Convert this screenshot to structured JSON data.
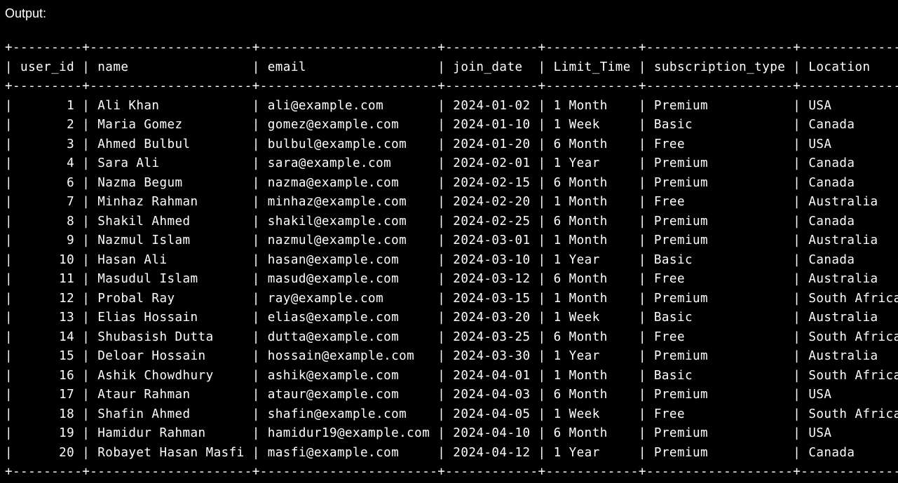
{
  "output_label": "Output:",
  "table": {
    "columns": [
      "user_id",
      "name",
      "email",
      "join_date",
      "Limit_Time",
      "subscription_type",
      "Location"
    ],
    "rows": [
      [
        "1",
        "Ali Khan",
        "ali@example.com",
        "2024-01-02",
        "1 Month",
        "Premium",
        "USA"
      ],
      [
        "2",
        "Maria Gomez",
        "gomez@example.com",
        "2024-01-10",
        "1 Week",
        "Basic",
        "Canada"
      ],
      [
        "3",
        "Ahmed Bulbul",
        "bulbul@example.com",
        "2024-01-20",
        "6 Month",
        "Free",
        "USA"
      ],
      [
        "4",
        "Sara Ali",
        "sara@example.com",
        "2024-02-01",
        "1 Year",
        "Premium",
        "Canada"
      ],
      [
        "6",
        "Nazma Begum",
        "nazma@example.com",
        "2024-02-15",
        "6 Month",
        "Premium",
        "Canada"
      ],
      [
        "7",
        "Minhaz Rahman",
        "minhaz@example.com",
        "2024-02-20",
        "1 Month",
        "Free",
        "Australia"
      ],
      [
        "8",
        "Shakil Ahmed",
        "shakil@example.com",
        "2024-02-25",
        "6 Month",
        "Premium",
        "Canada"
      ],
      [
        "9",
        "Nazmul Islam",
        "nazmul@example.com",
        "2024-03-01",
        "1 Month",
        "Premium",
        "Australia"
      ],
      [
        "10",
        "Hasan Ali",
        "hasan@example.com",
        "2024-03-10",
        "1 Year",
        "Basic",
        "Canada"
      ],
      [
        "11",
        "Masudul Islam",
        "masud@example.com",
        "2024-03-12",
        "6 Month",
        "Free",
        "Australia"
      ],
      [
        "12",
        "Probal Ray",
        "ray@example.com",
        "2024-03-15",
        "1 Month",
        "Premium",
        "South Africa"
      ],
      [
        "13",
        "Elias Hossain",
        "elias@example.com",
        "2024-03-20",
        "1 Week",
        "Basic",
        "Australia"
      ],
      [
        "14",
        "Shubasish Dutta",
        "dutta@example.com",
        "2024-03-25",
        "6 Month",
        "Free",
        "South Africa"
      ],
      [
        "15",
        "Deloar Hossain",
        "hossain@example.com",
        "2024-03-30",
        "1 Year",
        "Premium",
        "Australia"
      ],
      [
        "16",
        "Ashik Chowdhury",
        "ashik@example.com",
        "2024-04-01",
        "1 Month",
        "Basic",
        "South Africa"
      ],
      [
        "17",
        "Ataur Rahman",
        "ataur@example.com",
        "2024-04-03",
        "6 Month",
        "Premium",
        "USA"
      ],
      [
        "18",
        "Shafin Ahmed",
        "shafin@example.com",
        "2024-04-05",
        "1 Week",
        "Free",
        "South Africa"
      ],
      [
        "19",
        "Hamidur Rahman",
        "hamidur19@example.com",
        "2024-04-10",
        "6 Month",
        "Premium",
        "USA"
      ],
      [
        "20",
        "Robayet Hasan Masfi",
        "masfi@example.com",
        "2024-04-12",
        "1 Year",
        "Premium",
        "Canada"
      ]
    ]
  }
}
